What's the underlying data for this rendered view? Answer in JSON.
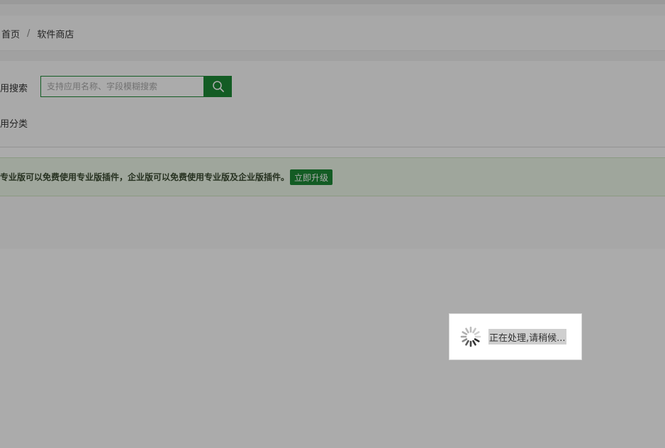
{
  "breadcrumb": {
    "home": "首页",
    "separator": "/",
    "current": "软件商店"
  },
  "filters": {
    "search_label": "用搜索",
    "search_placeholder": "支持应用名称、字段模糊搜索",
    "search_value": "",
    "search_button_icon": "search-icon",
    "category_label": "用分类"
  },
  "notice": {
    "text": "专业版可以免费使用专业版插件，企业版可以免费使用专业版及企业版插件。",
    "upgrade_label": "立即升级"
  },
  "loading": {
    "text": "正在处理,请稍候...",
    "icon": "spinner-icon"
  },
  "colors": {
    "accent": "#1d8a37",
    "notice_bg": "#eef8e9",
    "overlay": "rgba(0,0,0,0.33)"
  }
}
